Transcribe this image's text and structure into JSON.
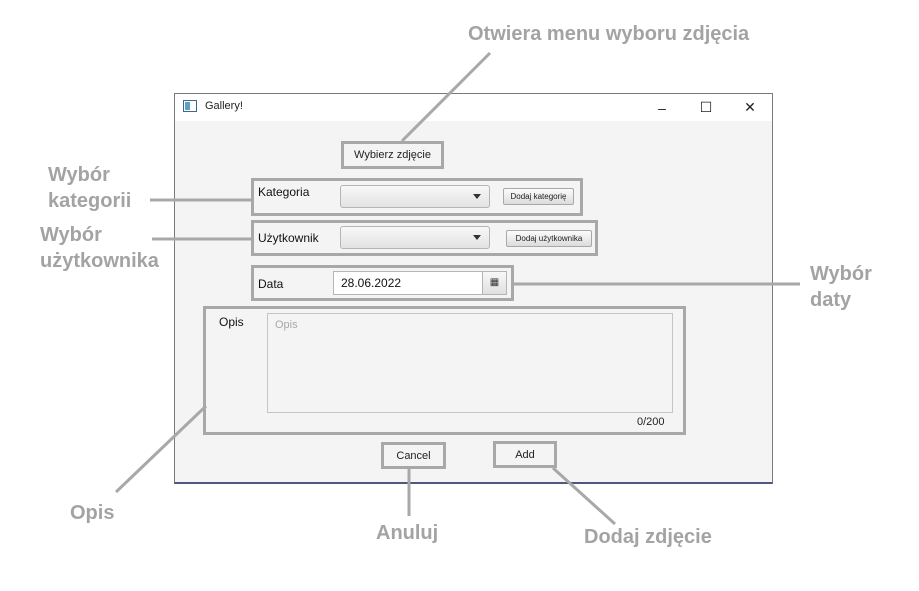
{
  "window": {
    "title": "Gallery!",
    "controls": {
      "minimize": "–",
      "maximize": "☐",
      "close": "✕"
    }
  },
  "form": {
    "choose_photo_button": "Wybierz zdjęcie",
    "category": {
      "label": "Kategoria",
      "selected": "",
      "add_button": "Dodaj kategorię"
    },
    "user": {
      "label": "Użytkownik",
      "selected": "",
      "add_button": "Dodaj użytkownika"
    },
    "date": {
      "label": "Data",
      "value": "28.06.2022",
      "calendar_icon": "calendar-icon"
    },
    "description": {
      "label": "Opis",
      "placeholder": "Opis",
      "counter": "0/200"
    },
    "cancel_button": "Cancel",
    "add_button": "Add"
  },
  "annotations": {
    "choose_photo": "Otwiera menu wyboru zdjęcia",
    "category_line1": "Wybór",
    "category_line2": "kategorii",
    "user_line1": "Wybór",
    "user_line2": "użytkownika",
    "date_line1": "Wybór",
    "date_line2": "daty",
    "description": "Opis",
    "cancel": "Anuluj",
    "add_photo": "Dodaj zdjęcie"
  },
  "colors": {
    "annotation": "#a3a3a3",
    "highlight_border": "#a8a8a8",
    "window_bg": "#f4f4f4"
  }
}
